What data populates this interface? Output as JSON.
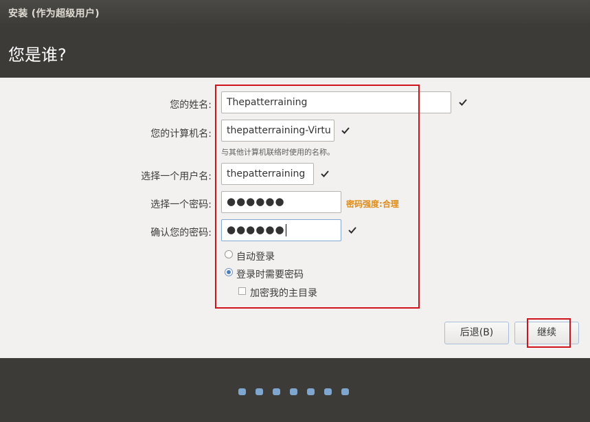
{
  "window": {
    "title": "安装 (作为超级用户)"
  },
  "header": {
    "title": "您是谁?"
  },
  "form": {
    "name_label": "您的姓名:",
    "name_value": "Thepatterraining",
    "computer_label": "您的计算机名:",
    "computer_value": "thepatterraining-Virtu",
    "computer_hint": "与其他计算机联络时使用的名称。",
    "username_label": "选择一个用户名:",
    "username_value": "thepatterraining",
    "password_label": "选择一个密码:",
    "password_value": "●●●●●●",
    "password_strength": "密码强度:合理",
    "confirm_label": "确认您的密码:",
    "confirm_value": "●●●●●●",
    "login_options": {
      "auto_login": "自动登录",
      "require_password": "登录时需要密码",
      "encrypt_home": "加密我的主目录",
      "selected": "require_password",
      "encrypt_home_checked": false
    }
  },
  "buttons": {
    "back": "后退(B)",
    "continue": "继续"
  },
  "progress": {
    "total_steps": 7
  },
  "colors": {
    "accent": "#4f7db8",
    "strength": "#e08b15",
    "highlight_box": "#d0121a",
    "header_bg": "#3c3b37",
    "content_bg": "#f2f1f0"
  },
  "icons": {
    "valid_check": "check-icon"
  }
}
